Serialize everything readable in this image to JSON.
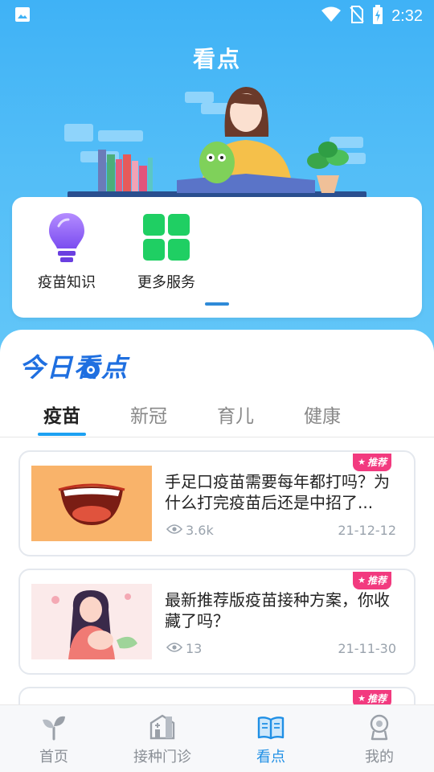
{
  "status_bar": {
    "time": "2:32"
  },
  "header": {
    "title": "看点"
  },
  "quick_actions": [
    {
      "label": "疫苗知识",
      "icon": "lightbulb-icon"
    },
    {
      "label": "更多服务",
      "icon": "grid-icon"
    }
  ],
  "section": {
    "title": "今日看点"
  },
  "tabs": [
    {
      "label": "疫苗",
      "active": true
    },
    {
      "label": "新冠",
      "active": false
    },
    {
      "label": "育儿",
      "active": false
    },
    {
      "label": "健康",
      "active": false
    }
  ],
  "articles": [
    {
      "badge": "推荐",
      "title": "手足口疫苗需要每年都打吗？为什么打完疫苗后还是中招了...",
      "views": "3.6k",
      "date": "21-12-12"
    },
    {
      "badge": "推荐",
      "title": "最新推荐版疫苗接种方案，你收藏了吗？",
      "views": "13",
      "date": "21-11-30"
    },
    {
      "badge": "推荐"
    }
  ],
  "bottom_nav": [
    {
      "label": "首页",
      "icon": "sprout-icon",
      "active": false
    },
    {
      "label": "接种门诊",
      "icon": "clinic-icon",
      "active": false
    },
    {
      "label": "看点",
      "icon": "book-icon",
      "active": true
    },
    {
      "label": "我的",
      "icon": "profile-icon",
      "active": false
    }
  ],
  "colors": {
    "accent": "#1f8fe5",
    "header_bg": "#3fb2f6",
    "badge": "#f23a7f"
  }
}
